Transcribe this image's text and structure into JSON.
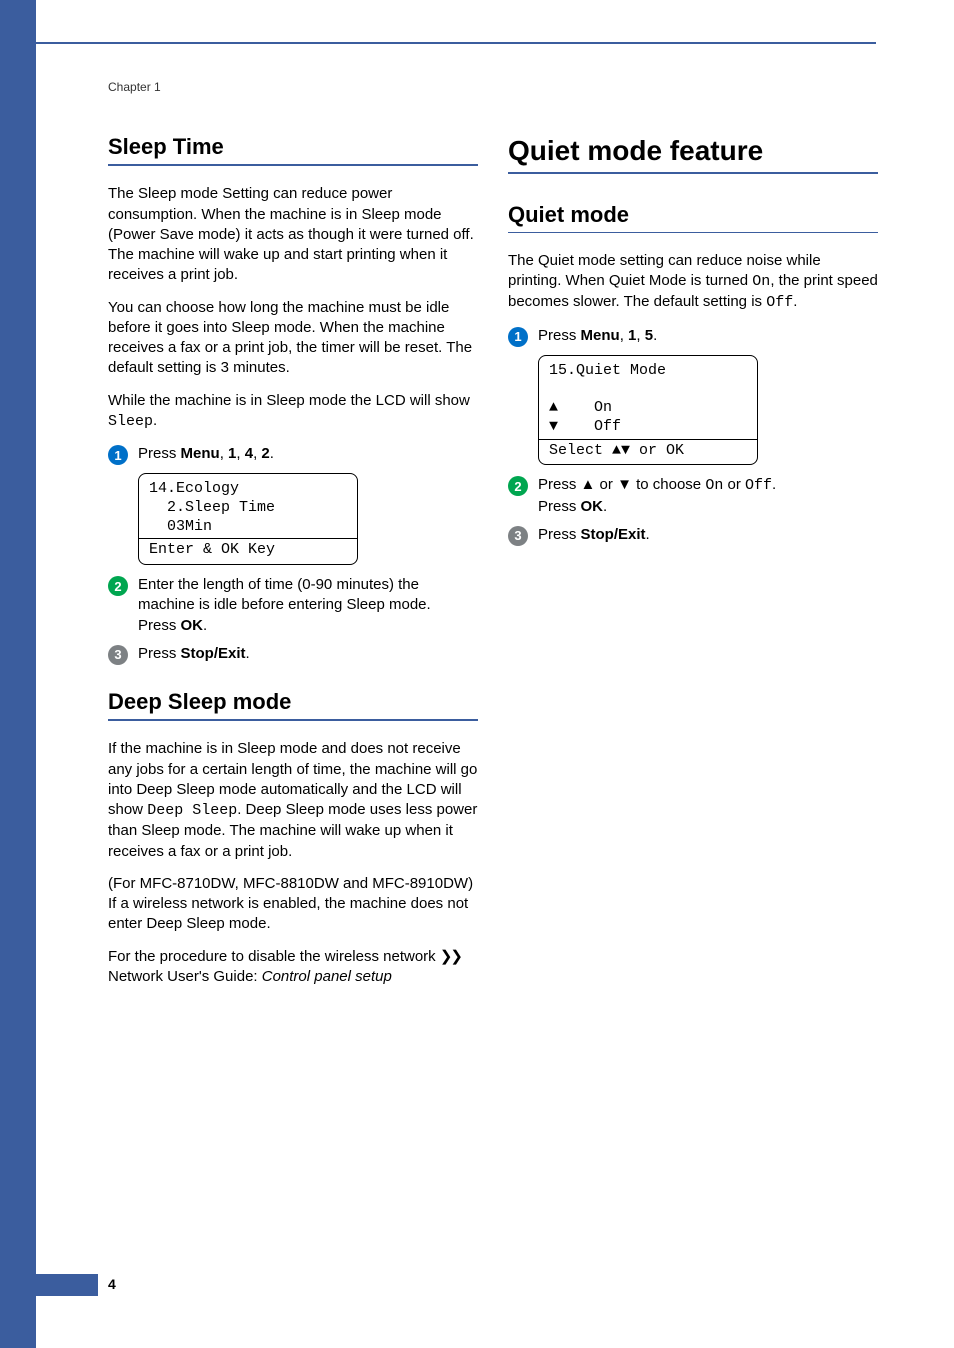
{
  "chapter_label": "Chapter 1",
  "page_number": "4",
  "left": {
    "section1": {
      "title": "Sleep Time",
      "para1": "The Sleep mode Setting can reduce power consumption. When the machine is in Sleep mode (Power Save mode) it acts as though it were turned off. The machine will wake up and start printing when it receives a print job.",
      "para2": "You can choose how long the machine must be idle before it goes into Sleep mode. When the machine receives a fax or a print job, the timer will be reset. The default setting is 3 minutes.",
      "para3_a": "While the machine is in Sleep mode the LCD will show ",
      "para3_mono": "Sleep",
      "para3_b": ".",
      "step1_a": "Press ",
      "step1_b": "Menu",
      "step1_c": ", ",
      "step1_d": "1",
      "step1_e": ", ",
      "step1_f": "4",
      "step1_g": ", ",
      "step1_h": "2",
      "step1_i": ".",
      "lcd_l1": "14.Ecology",
      "lcd_l2": "  2.Sleep Time",
      "lcd_l3": "",
      "lcd_l4": "  03Min",
      "lcd_l5": "Enter & OK Key",
      "step2_a": "Enter the length of time  (0-90 minutes) the machine is idle before entering Sleep mode.",
      "step2_b": "Press ",
      "step2_c": "OK",
      "step2_d": ".",
      "step3_a": "Press ",
      "step3_b": "Stop/Exit",
      "step3_c": "."
    },
    "section2": {
      "title": "Deep Sleep mode",
      "para1_a": "If the machine is in Sleep mode and does not receive any jobs for a certain length of time, the machine will go into Deep Sleep mode automatically and the LCD will show ",
      "para1_mono": "Deep Sleep",
      "para1_b": ". Deep Sleep mode uses less power than Sleep mode. The machine will wake up when it receives a fax or a print job.",
      "para2": "(For MFC-8710DW, MFC-8810DW and MFC-8910DW) If a wireless network is enabled, the machine does not enter Deep Sleep mode.",
      "para3_a": "For the procedure to disable the wireless network ",
      "para3_chev": "❯❯",
      "para3_b": " Network User's Guide: ",
      "para3_i": "Control panel setup"
    }
  },
  "right": {
    "section1": {
      "title": "Quiet mode feature",
      "sub_title": "Quiet mode",
      "para1_a": "The Quiet mode setting can reduce noise while printing. When Quiet Mode is turned ",
      "para1_m1": "On",
      "para1_b": ", the print speed becomes slower. The default setting is ",
      "para1_m2": "Off",
      "para1_c": ".",
      "step1_a": "Press ",
      "step1_b": "Menu",
      "step1_c": ", ",
      "step1_d": "1",
      "step1_e": ", ",
      "step1_f": "5",
      "step1_g": ".",
      "lcd_l1": "15.Quiet Mode",
      "lcd_l2": "",
      "lcd_l3": "a    On",
      "lcd_l4": "b    Off",
      "lcd_l5": "Select ab or OK",
      "step2_a": "Press ",
      "step2_up": "a",
      "step2_b": " or ",
      "step2_dn": "b",
      "step2_c": " to choose ",
      "step2_m1": "On",
      "step2_d": " or ",
      "step2_m2": "Off",
      "step2_e": ".",
      "step2_f": "Press ",
      "step2_g": "OK",
      "step2_h": ".",
      "step3_a": "Press ",
      "step3_b": "Stop/Exit",
      "step3_c": "."
    }
  }
}
